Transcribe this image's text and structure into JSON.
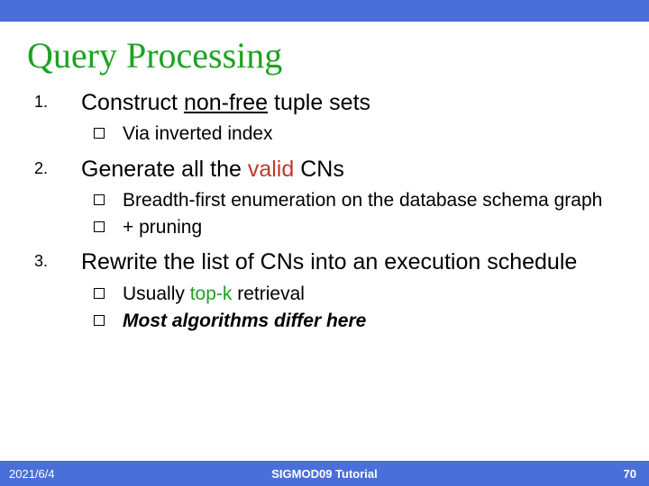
{
  "title": "Query Processing",
  "items": [
    {
      "prefix": "Construct ",
      "underlined": "non-free",
      "suffix": " tuple sets",
      "subs": [
        {
          "text": "Via inverted index"
        }
      ]
    },
    {
      "prefix": "Generate all the ",
      "red": "valid",
      "suffix": " CNs",
      "subs": [
        {
          "text": "Breadth-first enumeration on the database schema graph"
        },
        {
          "text": "+ pruning"
        }
      ]
    },
    {
      "text": "Rewrite the list of CNs into an execution schedule",
      "subs": [
        {
          "prefix": "Usually ",
          "green": "top-k",
          "suffix": " retrieval"
        },
        {
          "boldItalic": "Most algorithms differ here"
        }
      ]
    }
  ],
  "footer": {
    "date": "2021/6/4",
    "center": "SIGMOD09 Tutorial",
    "page": "70"
  }
}
